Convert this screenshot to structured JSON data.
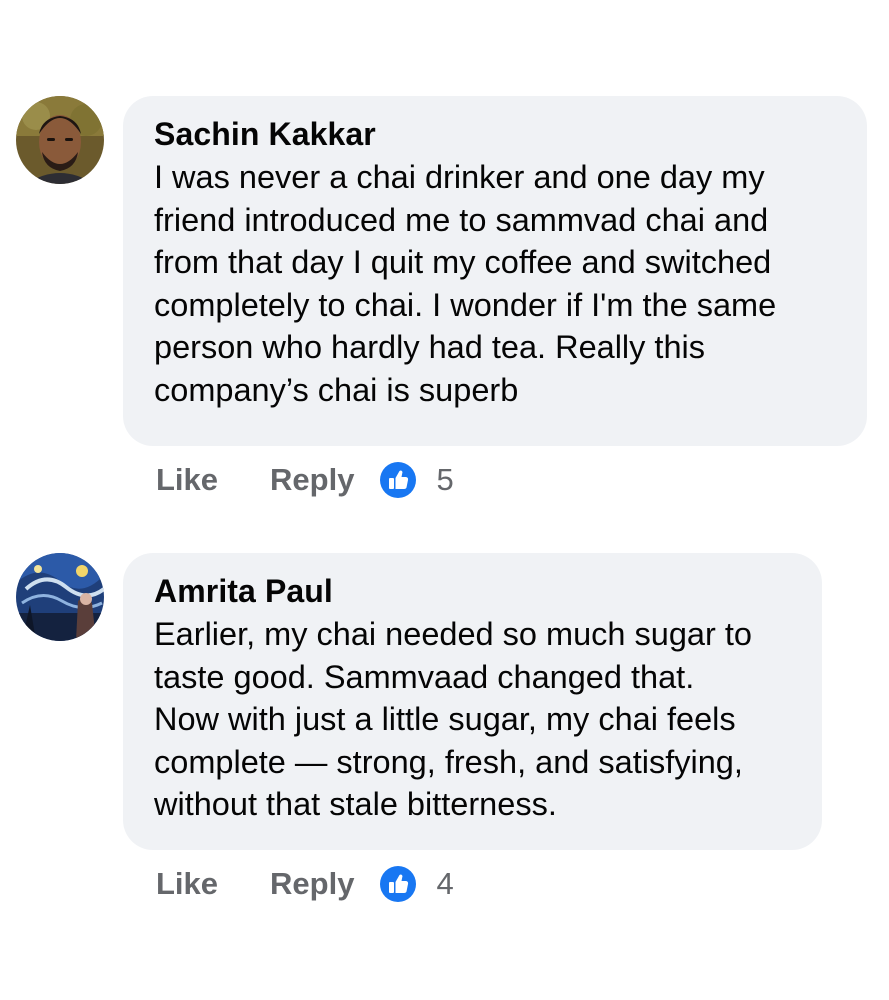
{
  "colors": {
    "bubble_bg": "#f0f2f5",
    "text": "#050505",
    "secondary": "#65676b",
    "like_blue": "#1877f2"
  },
  "comments": [
    {
      "author": "Sachin Kakkar",
      "text": "I was never a chai drinker and one day my\nfriend introduced me to sammvad chai and\nfrom that day I quit my coffee and switched\ncompletely to chai. I wonder if I'm the same\nperson who hardly had tea. Really this\ncompany’s chai is superb",
      "like_label": "Like",
      "reply_label": "Reply",
      "reaction_icon": "like-icon",
      "reaction_count": "5"
    },
    {
      "author": "Amrita Paul",
      "text": "Earlier, my chai needed so much sugar to\ntaste good. Sammvaad changed that.\nNow with just a little sugar, my chai feels\ncomplete — strong, fresh, and satisfying,\nwithout that stale bitterness.",
      "like_label": "Like",
      "reply_label": "Reply",
      "reaction_icon": "like-icon",
      "reaction_count": "4"
    }
  ]
}
